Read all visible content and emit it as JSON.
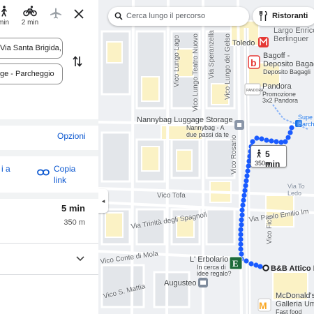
{
  "panel": {
    "modes": [
      {
        "name": "walk",
        "label": "min"
      },
      {
        "name": "bike",
        "label": "2 min"
      },
      {
        "name": "flight",
        "label": ""
      }
    ],
    "origin_value": "Via Santa Brigida,",
    "destination_value": "ge - Parcheggio",
    "options_label": "Opzioni",
    "share_partial": "i a",
    "copy_link_line1": "Copia",
    "copy_link_line2": "link",
    "route_duration": "5 min",
    "route_distance": "350 m"
  },
  "map": {
    "search_placeholder": "Cerca lungo il percorso",
    "chip_label": "Ristoranti",
    "route_color": "#1a5bff",
    "callout": {
      "time": "5 min",
      "distance": "350m"
    },
    "places": {
      "toledo": "Toledo",
      "largo1": "Largo Enrico",
      "largo2": "Berlinguer",
      "bagoff1": "Bagoff -",
      "bagoff2": "Deposito Bagag",
      "bagoff3": "Deposito Bagagli",
      "pandora1": "Pandora",
      "pandora2": "Promozione",
      "pandora3": "3x2 Pandora",
      "nanny1": "Nannybag Luggage Storage",
      "nanny2": "Nannybag - A",
      "nanny3": "due passi da te",
      "super1": "Supe",
      "super2": "Parch",
      "vto1": "Via To",
      "vto2": "Ledo",
      "erbo1": "L' Erbolario",
      "erbo2": "In cerca di",
      "erbo3": "idee regalo?",
      "bnb": "B&B Attico P",
      "augusteo": "Augusteo",
      "mcd1": "McDonald's",
      "mcd2": "Galleria Um",
      "mcd3": "Fast food"
    },
    "streets": {
      "tofa": "Vico Tofa",
      "trinita": "Via Trinità degli Spagnoli",
      "conte": "Vico Conte di Mola",
      "mattia": "Vico S. Mattia",
      "paolo": "Via Paolo Emilio Im",
      "fico": "Vico Fico",
      "lungo_lago": "Vico Lungo Lago",
      "lungo_teatro": "Vico Lungo Teatro Nuovo",
      "speranzella": "Via Speranzella",
      "lungo_gelso": "Vico Lungo del Gelso",
      "rosario": "Vico Rosario"
    }
  }
}
